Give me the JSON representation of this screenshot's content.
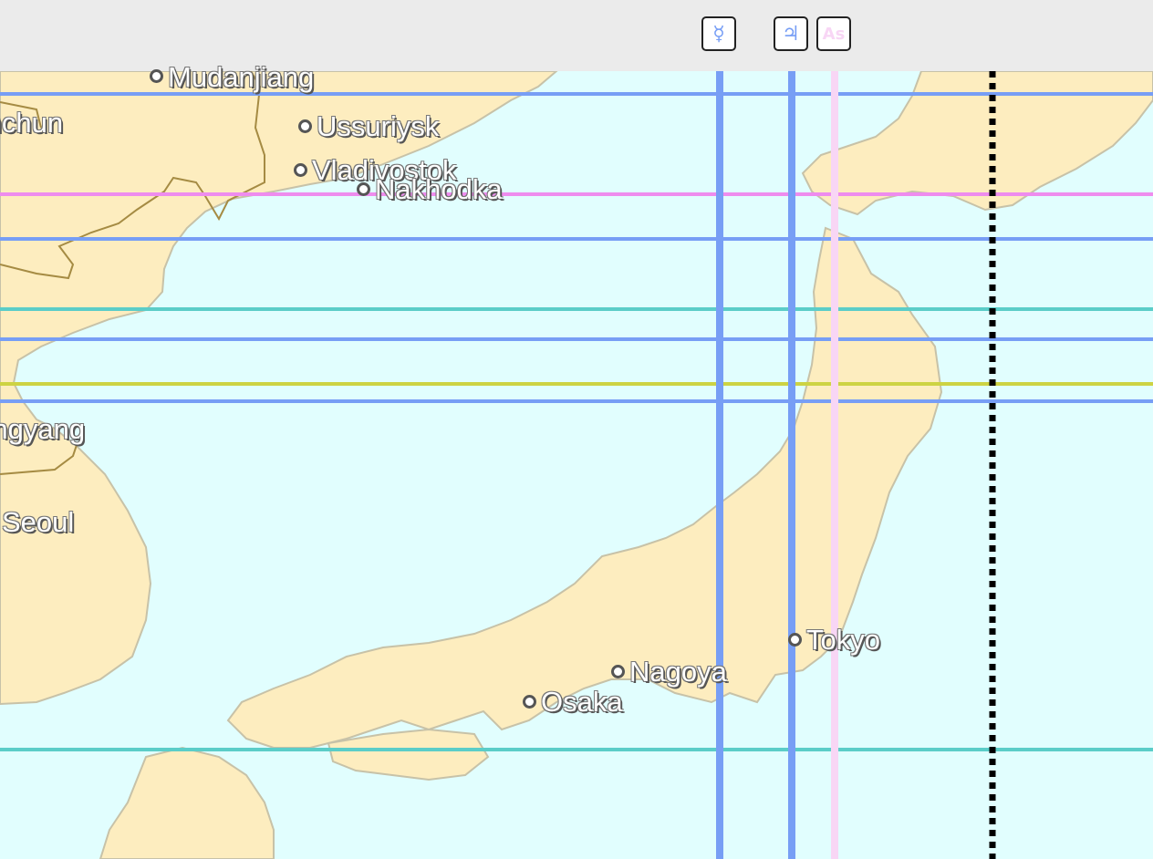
{
  "colors": {
    "sea": "#e1fefe",
    "land": "#fdedbf",
    "coast": "#c7c2a8",
    "border": "#a58b43",
    "blue_line": "#779ef5",
    "pink_line": "#ee8cee",
    "teal_line": "#5bcdc8",
    "yellow_line": "#cdd343",
    "light_pink_line": "#f8d6f5",
    "black_dotted": "#000000",
    "toolbar": "#ebebeb"
  },
  "markers": [
    {
      "id": "mercury",
      "glyph": "☿",
      "icon": "mercury-icon",
      "color": "#779ef5"
    },
    {
      "id": "jupiter",
      "glyph": "♃",
      "icon": "jupiter-icon",
      "color": "#779ef5"
    },
    {
      "id": "ascendant",
      "glyph": "As",
      "icon": "ascendant-icon",
      "color": "#f8d6f5"
    }
  ],
  "cities": [
    {
      "name": "Mudanjiang"
    },
    {
      "name": "Ussuriysk"
    },
    {
      "name": "Vladivostok"
    },
    {
      "name": "Nakhodka"
    },
    {
      "name": "Hunchun"
    },
    {
      "name": "Pyongyang"
    },
    {
      "name": "Seoul"
    },
    {
      "name": "Tokyo"
    },
    {
      "name": "Nagoya"
    },
    {
      "name": "Osaka"
    }
  ]
}
